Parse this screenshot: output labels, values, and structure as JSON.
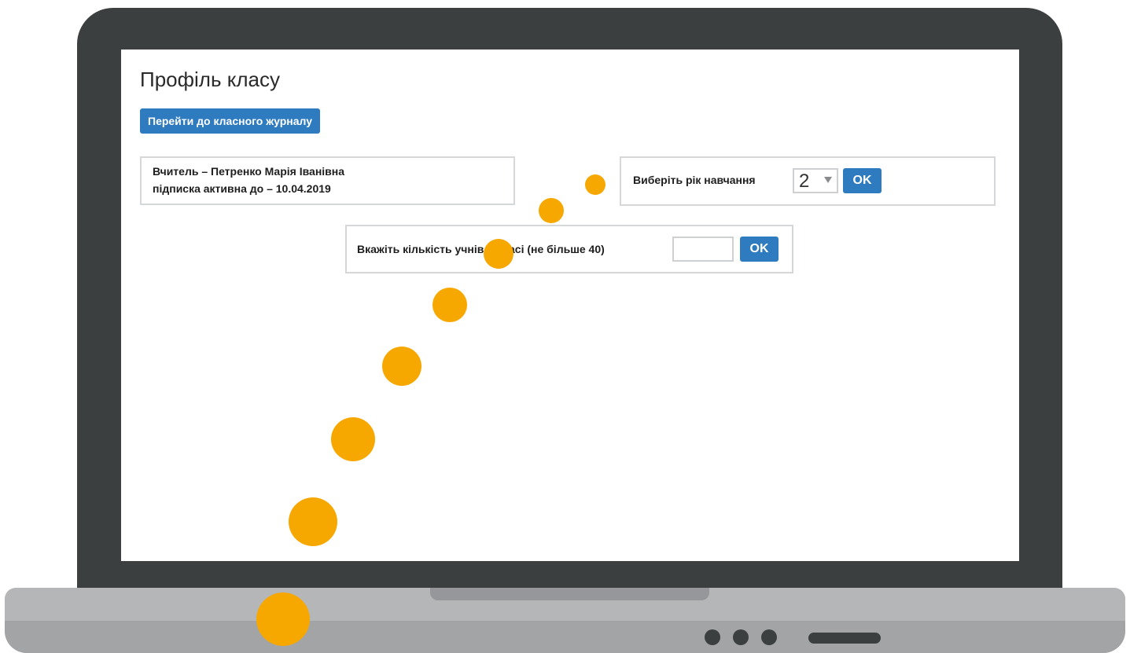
{
  "page": {
    "title": "Профіль класу",
    "journal_button_label": "Перейти до класного журналу"
  },
  "teacher_panel": {
    "teacher_line": "Вчитель – Петренко Марія Іванівна",
    "subscription_line": "підписка активна до – 10.04.2019"
  },
  "year_panel": {
    "label": "Виберіть рік навчання",
    "selected_year": "2",
    "ok_label": "OK"
  },
  "count_panel": {
    "label": "Вкажіть кількість учнів у класі (не більше 40)",
    "input_value": "",
    "ok_label": "OK"
  },
  "colors": {
    "accent": "#2e7bbf",
    "dots": "#f7a800",
    "laptop_frame": "#3b3f40",
    "laptop_base": "#b5b6b8"
  }
}
